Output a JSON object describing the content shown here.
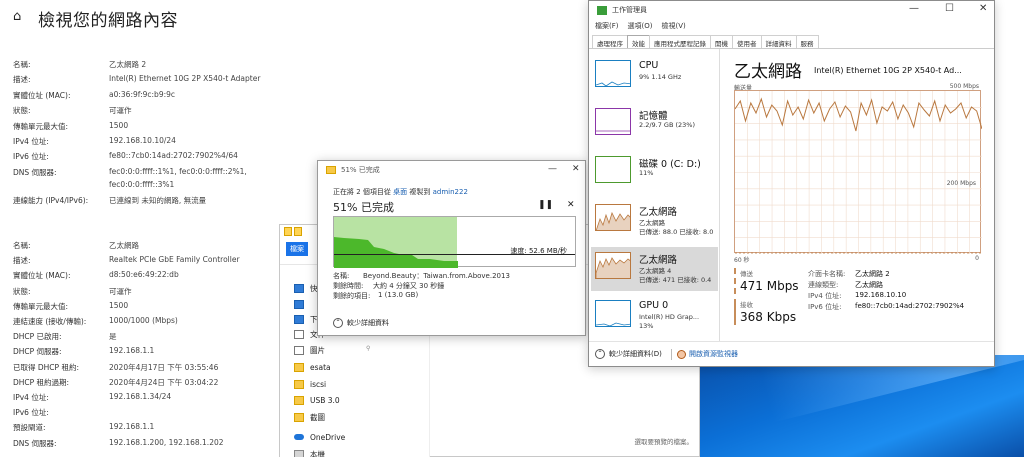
{
  "settings": {
    "title": "檢視您的網路內容",
    "adapter1": [
      {
        "key": "名稱:",
        "value": "乙太網路 2"
      },
      {
        "key": "描述:",
        "value": "Intel(R) Ethernet 10G 2P X540-t Adapter"
      },
      {
        "key": "實體位址 (MAC):",
        "value": "a0:36:9f:9c:b9:9c"
      },
      {
        "key": "狀態:",
        "value": "可運作"
      },
      {
        "key": "傳輸單元最大值:",
        "value": "1500"
      },
      {
        "key": "IPv4 位址:",
        "value": "192.168.10.10/24"
      },
      {
        "key": "IPv6 位址:",
        "value": "fe80::7cb0:14ad:2702:7902%4/64"
      },
      {
        "key": "DNS 伺服器:",
        "value": "fec0:0:0:ffff::1%1, fec0:0:0:ffff::2%1,"
      }
    ],
    "adapter1_dns_cont": "fec0:0:0:ffff::3%1",
    "adapter1_conn": {
      "key": "連線能力 (IPv4/IPv6):",
      "value": "已連線到 未知的網路, 無流量"
    },
    "adapter2": [
      {
        "key": "名稱:",
        "value": "乙太網路"
      },
      {
        "key": "描述:",
        "value": "Realtek PCIe GbE Family Controller"
      },
      {
        "key": "實體位址 (MAC):",
        "value": "d8:50:e6:49:22:db"
      },
      {
        "key": "狀態:",
        "value": "可運作"
      },
      {
        "key": "傳輸單元最大值:",
        "value": "1500"
      },
      {
        "key": "連結速度 (接收/傳輸):",
        "value": "1000/1000 (Mbps)"
      },
      {
        "key": "DHCP 已啟用:",
        "value": "是"
      },
      {
        "key": "DHCP 伺服器:",
        "value": "192.168.1.1"
      },
      {
        "key": "已取得 DHCP 租約:",
        "value": "2020年4月17日 下午 03:55:46"
      },
      {
        "key": "DHCP 租約過期:",
        "value": "2020年4月24日 下午 03:04:22"
      },
      {
        "key": "IPv4 位址:",
        "value": "192.168.1.34/24"
      },
      {
        "key": "IPv6 位址:",
        "value": ""
      },
      {
        "key": "預設閘道:",
        "value": "192.168.1.1"
      },
      {
        "key": "DNS 伺服器:",
        "value": "192.168.1.200, 192.168.1.202"
      }
    ]
  },
  "explorer": {
    "file_tab": "檔案",
    "nav": [
      {
        "label": "快",
        "icon": "star-folder-icon"
      },
      {
        "label": "",
        "icon": "blue-folder-icon"
      },
      {
        "label": "下",
        "icon": "download-icon"
      },
      {
        "label": "文件",
        "icon": "documents-icon"
      },
      {
        "label": "圖片",
        "icon": "pictures-icon"
      },
      {
        "label": "esata",
        "icon": "folder-icon"
      },
      {
        "label": "iscsi",
        "icon": "folder-icon"
      },
      {
        "label": "USB 3.0",
        "icon": "folder-icon"
      },
      {
        "label": "截圖",
        "icon": "folder-icon"
      },
      {
        "label": "OneDrive",
        "icon": "onedrive-icon"
      },
      {
        "label": "本機",
        "icon": "this-pc-icon"
      }
    ],
    "status": "選取要預覽的檔案。"
  },
  "copy_dialog": {
    "title": "51% 已完成",
    "line1_prefix": "正在將 2 個項目從",
    "from": "桌面",
    "line1_mid": "複製到",
    "to": "admin222",
    "percent_text": "51% 已完成",
    "progress": 0.51,
    "speed": "速度: 52.6 MB/秒",
    "name_label": "名稱:",
    "name_value": "Beyond.Beauty：Taiwan.from.Above.2013",
    "time_label": "剩餘時間:",
    "time_value": "大約 4 分鐘又 30 秒鐘",
    "items_label": "剩餘的項目:",
    "items_value": "1 (13.0 GB)",
    "less_details": "較少詳細資料"
  },
  "task_manager": {
    "title": "工作管理員",
    "menu": [
      "檔案(F)",
      "選項(O)",
      "檢視(V)"
    ],
    "tabs": [
      "處理程序",
      "效能",
      "應用程式歷程記錄",
      "開機",
      "使用者",
      "詳細資料",
      "服務"
    ],
    "active_tab": "效能",
    "resources": [
      {
        "name": "CPU",
        "sub1": "9% 1.14 GHz",
        "sub2": "",
        "color": "#1a7fc1"
      },
      {
        "name": "記憶體",
        "sub1": "2.2/9.7 GB (23%)",
        "sub2": "",
        "color": "#8b36a8"
      },
      {
        "name": "磁碟 0 (C: D:)",
        "sub1": "11%",
        "sub2": "",
        "color": "#4d9a2e"
      },
      {
        "name": "乙太網路",
        "sub1": "乙太網路",
        "sub2": "已傳送: 88.0 已接收: 8.0",
        "color": "#b9783f"
      },
      {
        "name": "乙太網路",
        "sub1": "乙太網路 4",
        "sub2": "已傳送: 471 已接收: 0.4",
        "color": "#b9783f"
      },
      {
        "name": "GPU 0",
        "sub1": "Intel(R) HD Grap...",
        "sub2": "13%",
        "color": "#1a7fc1"
      }
    ],
    "selected_index": 4,
    "heading": "乙太網路",
    "adapter": "Intel(R) Ethernet 10G 2P X540-t Ad...",
    "axis_top_left": "輸送量",
    "axis_top_right": "500 Mbps",
    "axis_mid_right": "200 Mbps",
    "axis_bottom_left": "60 秒",
    "axis_bottom_right": "0",
    "send_label": "傳送",
    "send_value": "471 Mbps",
    "recv_label": "接收",
    "recv_value": "368 Kbps",
    "details": [
      {
        "key": "介面卡名稱:",
        "value": "乙太網路 2"
      },
      {
        "key": "連線類型:",
        "value": "乙太網路"
      },
      {
        "key": "IPv4 位址:",
        "value": "192.168.10.10"
      },
      {
        "key": "IPv6 位址:",
        "value": "fe80::7cb0:14ad:2702:7902%4"
      }
    ],
    "less_details": "較少詳細資料(D)",
    "resource_monitor": "開啟資源監視器"
  }
}
